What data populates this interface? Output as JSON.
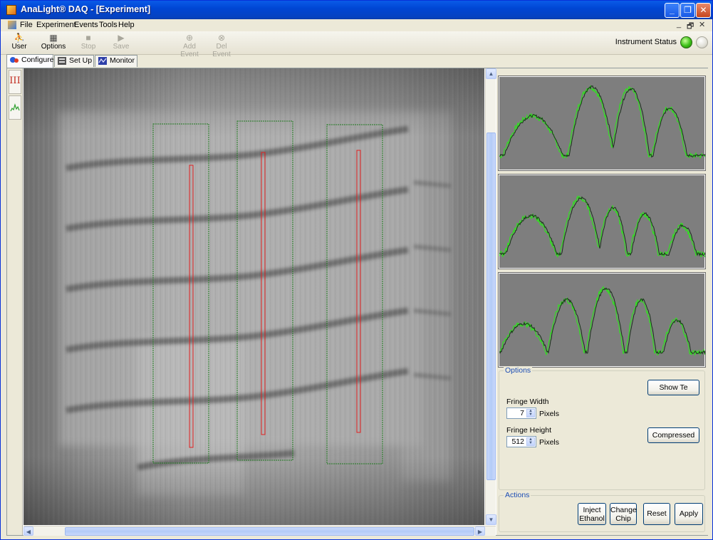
{
  "window": {
    "title": "AnaLight® DAQ - [Experiment]"
  },
  "menu": {
    "items": [
      "File",
      "Experiment",
      "Events",
      "Tools",
      "Help"
    ]
  },
  "toolbar": {
    "user": "User",
    "options": "Options",
    "stop": "Stop",
    "save": "Save",
    "add_event": "Add Event",
    "del_event": "Del Event",
    "instrument_status": "Instrument Status"
  },
  "tabs": [
    "Configure",
    "Set Up",
    "Monitor"
  ],
  "sidebar": {
    "tab1": "III"
  },
  "options_panel": {
    "legend": "Options",
    "show_te": "Show Te",
    "fringe_width_label": "Fringe Width",
    "fringe_width_value": "7",
    "fringe_width_unit": "Pixels",
    "fringe_height_label": "Fringe Height",
    "fringe_height_value": "512",
    "fringe_height_unit": "Pixels",
    "compressed": "Compressed"
  },
  "actions_panel": {
    "legend": "Actions",
    "inject_ethanol_1": "Inject",
    "inject_ethanol_2": "Ethanol",
    "change_chip_1": "Change",
    "change_chip_2": "Chip",
    "reset": "Reset",
    "apply": "Apply"
  },
  "colors": {
    "roi_box": "#1f7a1f",
    "roi_line": "#e02020",
    "trace_green": "#33dd22",
    "trace_dark": "#1a331a",
    "led_on": "#3bbf16"
  },
  "icons": [
    "app-icon",
    "user-icon",
    "options-icon",
    "stop-icon",
    "save-icon",
    "add-event-icon",
    "del-event-icon",
    "configure-icon",
    "setup-icon",
    "monitor-icon",
    "fringe-icon",
    "waveform-icon"
  ]
}
